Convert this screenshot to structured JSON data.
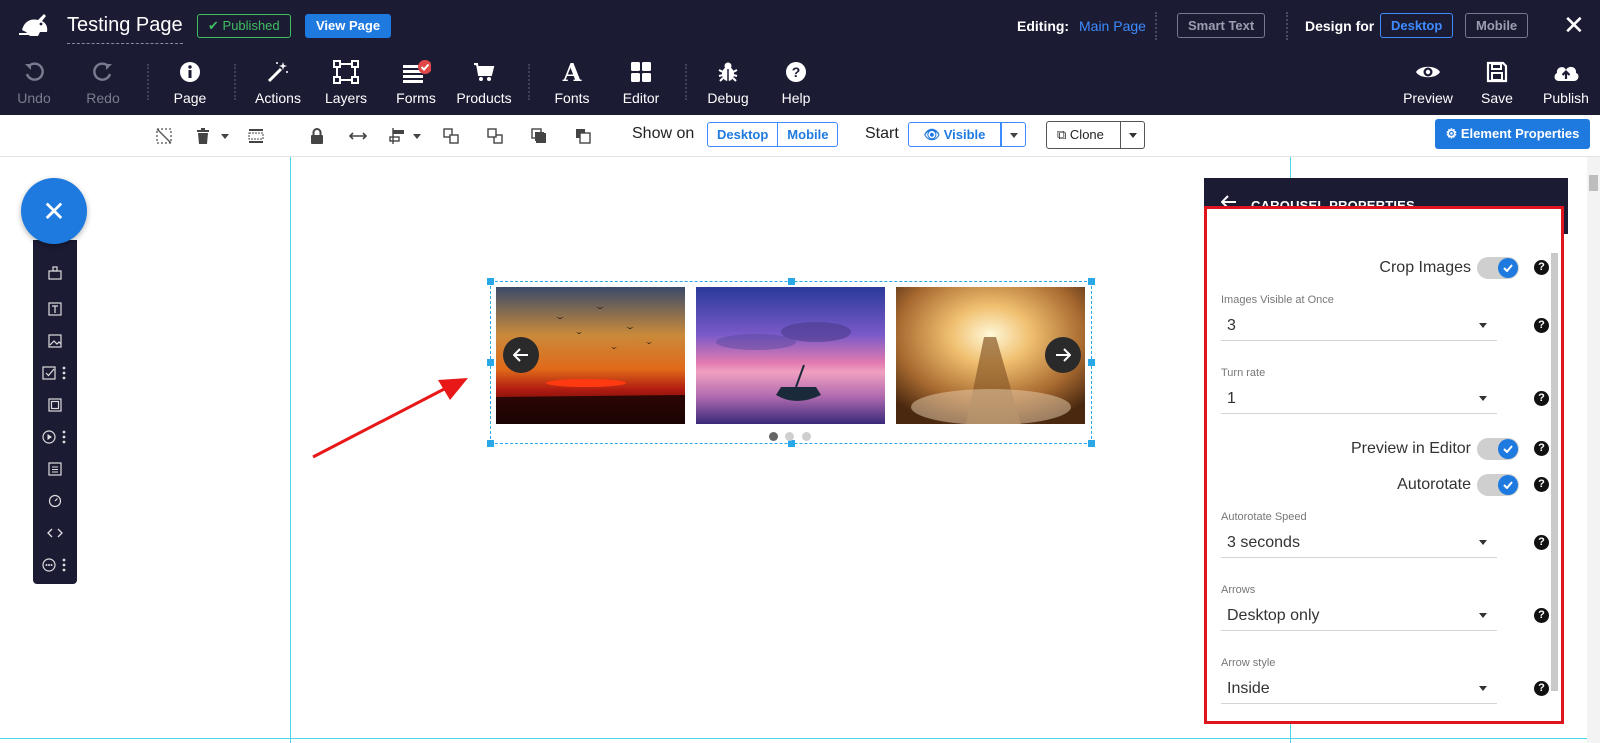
{
  "header": {
    "page_title": "Testing Page",
    "published_label": "Published",
    "view_page_label": "View Page",
    "editing_label": "Editing:",
    "editing_target": "Main Page",
    "smart_text_label": "Smart Text",
    "design_for_label": "Design for",
    "desktop_label": "Desktop",
    "mobile_label": "Mobile"
  },
  "toolbar": {
    "undo": "Undo",
    "redo": "Redo",
    "page": "Page",
    "actions": "Actions",
    "layers": "Layers",
    "forms": "Forms",
    "products": "Products",
    "fonts": "Fonts",
    "editor": "Editor",
    "debug": "Debug",
    "help": "Help",
    "preview": "Preview",
    "save": "Save",
    "publish": "Publish"
  },
  "toolbar2": {
    "show_on_label": "Show on",
    "desktop": "Desktop",
    "mobile": "Mobile",
    "start_label": "Start",
    "visible": "Visible",
    "clone": "Clone",
    "element_properties": "Element Properties"
  },
  "panel": {
    "title": "CAROUSEL PROPERTIES",
    "crop_images_label": "Crop Images",
    "images_visible_label": "Images Visible at Once",
    "images_visible_value": "3",
    "turn_rate_label": "Turn rate",
    "turn_rate_value": "1",
    "preview_in_editor_label": "Preview in Editor",
    "autorotate_label": "Autorotate",
    "autorotate_speed_label": "Autorotate Speed",
    "autorotate_speed_value": "3 seconds",
    "arrows_label": "Arrows",
    "arrows_value": "Desktop only",
    "arrow_style_label": "Arrow style",
    "arrow_style_value": "Inside",
    "crop_images_on": true,
    "preview_in_editor_on": true,
    "autorotate_on": true
  },
  "carousel": {
    "slide_count": 3,
    "active_dot": 0
  },
  "colors": {
    "header_bg": "#1c1b34",
    "accent_blue": "#1f7ae0",
    "published_green": "#3fbf5f",
    "highlight_red": "#e0141e",
    "guide_cyan": "#4ed6e6"
  }
}
